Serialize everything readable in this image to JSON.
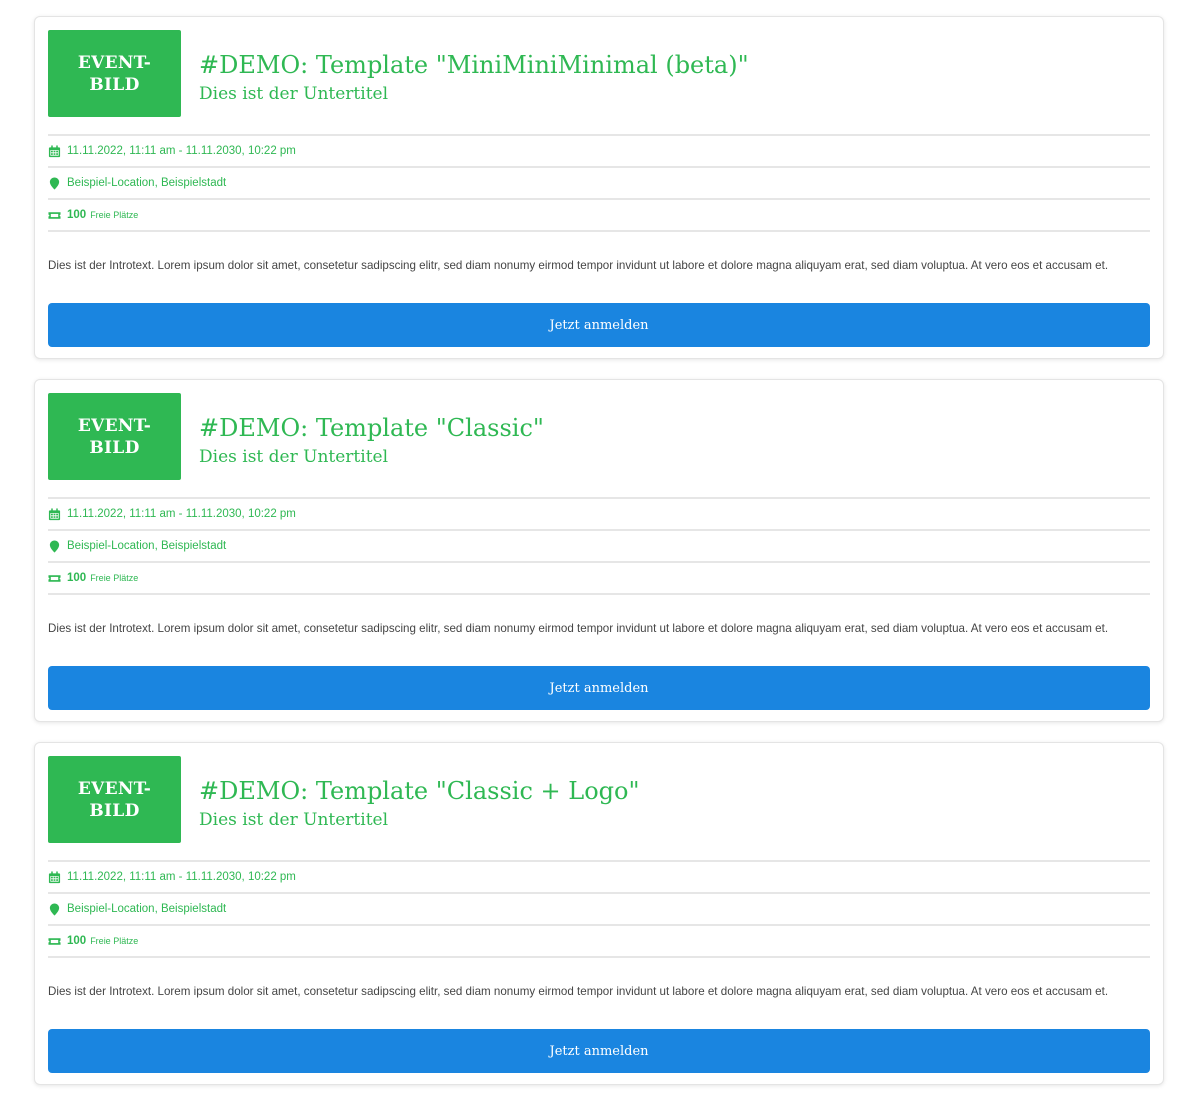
{
  "colors": {
    "accent": "#2fb853",
    "button": "#1a85e0",
    "text": "#454545",
    "divider": "#e6e6e6"
  },
  "events": [
    {
      "image_text": "EVENT-\nBILD",
      "title": "#DEMO: Template \"MiniMiniMinimal (beta)\"",
      "subtitle": "Dies ist der Untertitel",
      "date": "11.11.2022, 11:11 am - 11.11.2030, 10:22 pm",
      "location": "Beispiel-Location, Beispielstadt",
      "seats_count": "100",
      "seats_label": "Freie Plätze",
      "intro": "Dies ist der Introtext. Lorem ipsum dolor sit amet, consetetur sadipscing elitr, sed diam nonumy eirmod tempor invidunt ut labore et dolore magna aliquyam erat, sed diam voluptua. At vero eos et accusam et.",
      "button_label": "Jetzt anmelden"
    },
    {
      "image_text": "EVENT-\nBILD",
      "title": "#DEMO: Template \"Classic\"",
      "subtitle": "Dies ist der Untertitel",
      "date": "11.11.2022, 11:11 am - 11.11.2030, 10:22 pm",
      "location": "Beispiel-Location, Beispielstadt",
      "seats_count": "100",
      "seats_label": "Freie Plätze",
      "intro": "Dies ist der Introtext. Lorem ipsum dolor sit amet, consetetur sadipscing elitr, sed diam nonumy eirmod tempor invidunt ut labore et dolore magna aliquyam erat, sed diam voluptua. At vero eos et accusam et.",
      "button_label": "Jetzt anmelden"
    },
    {
      "image_text": "EVENT-\nBILD",
      "title": "#DEMO: Template \"Classic + Logo\"",
      "subtitle": "Dies ist der Untertitel",
      "date": "11.11.2022, 11:11 am - 11.11.2030, 10:22 pm",
      "location": "Beispiel-Location, Beispielstadt",
      "seats_count": "100",
      "seats_label": "Freie Plätze",
      "intro": "Dies ist der Introtext. Lorem ipsum dolor sit amet, consetetur sadipscing elitr, sed diam nonumy eirmod tempor invidunt ut labore et dolore magna aliquyam erat, sed diam voluptua. At vero eos et accusam et.",
      "button_label": "Jetzt anmelden"
    }
  ]
}
